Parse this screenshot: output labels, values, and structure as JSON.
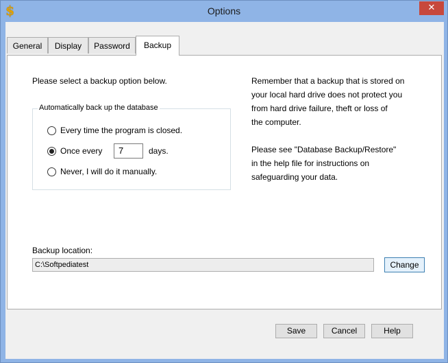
{
  "window": {
    "title": "Options",
    "close_label": "✕",
    "app_icon_glyph": "$"
  },
  "tabs": [
    {
      "label": "General"
    },
    {
      "label": "Display"
    },
    {
      "label": "Password"
    },
    {
      "label": "Backup"
    }
  ],
  "active_tab": "Backup",
  "backup": {
    "intro": "Please select a backup option below.",
    "group_label": "Automatically back up the database",
    "options": [
      {
        "label": "Every time the program is closed.",
        "selected": false
      },
      {
        "label": "Once every",
        "selected": true
      },
      {
        "label": "Never, I will do it manually.",
        "selected": false
      }
    ],
    "days_value": "7",
    "days_suffix": "days.",
    "note_lines": [
      "Remember that a backup that is stored on",
      "your local hard drive does not protect you",
      "from hard drive failure, theft or loss of",
      "the computer."
    ],
    "help_lines": [
      "Please see \"Database Backup/Restore\"",
      "in the help file for instructions on",
      "safeguarding your data."
    ],
    "location_label": "Backup location:",
    "location_value": "C:\\Softpediatest",
    "change_label": "Change"
  },
  "footer": {
    "save_label": "Save",
    "cancel_label": "Cancel",
    "help_label": "Help"
  }
}
